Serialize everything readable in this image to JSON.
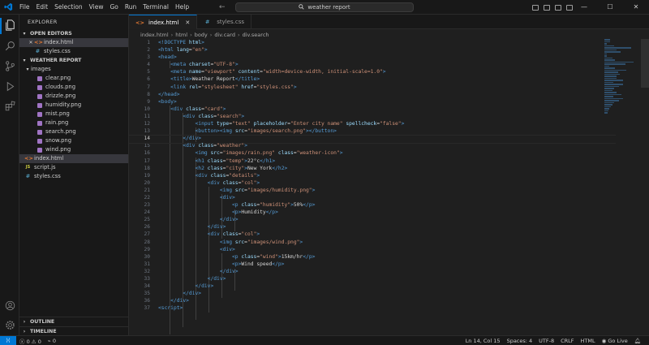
{
  "titlebar": {
    "menu": [
      "File",
      "Edit",
      "Selection",
      "View",
      "Go",
      "Run",
      "Terminal",
      "Help"
    ],
    "search": "weather report"
  },
  "sidebar": {
    "title": "EXPLORER",
    "open_editors_label": "OPEN EDITORS",
    "open_editors": [
      {
        "icon": "<>",
        "name": "index.html",
        "selected": true,
        "closable": true
      },
      {
        "icon": "#",
        "name": "styles.css",
        "selected": false,
        "closable": false
      }
    ],
    "project_label": "WEATHER REPORT",
    "images_folder": "images",
    "images": [
      "clear.png",
      "clouds.png",
      "drizzle.png",
      "humidity.png",
      "mist.png",
      "rain.png",
      "search.png",
      "snow.png",
      "wind.png"
    ],
    "root_files": [
      {
        "icon": "<>",
        "name": "index.html",
        "selected": true
      },
      {
        "icon": "JS",
        "name": "script.js",
        "selected": false
      },
      {
        "icon": "#",
        "name": "styles.css",
        "selected": false
      }
    ],
    "outline_label": "OUTLINE",
    "timeline_label": "TIMELINE"
  },
  "tabs": [
    {
      "icon": "<>",
      "label": "index.html",
      "active": true
    },
    {
      "icon": "#",
      "label": "styles.css",
      "active": false
    }
  ],
  "breadcrumb": [
    "index.html",
    "html",
    "body",
    "div.card",
    "div.search"
  ],
  "editor": {
    "current_line": 14,
    "lines": [
      [
        [
          "t-tag",
          "<!DOCTYPE "
        ],
        [
          "t-attr",
          "html"
        ],
        [
          "t-tag",
          ">"
        ]
      ],
      [
        [
          "t-tag",
          "<html "
        ],
        [
          "t-attr",
          "lang"
        ],
        [
          "t-text",
          "="
        ],
        [
          "t-str",
          "\"en\""
        ],
        [
          "t-tag",
          ">"
        ]
      ],
      [
        [
          "t-tag",
          "<head>"
        ]
      ],
      [
        [
          "t-text",
          "    "
        ],
        [
          "t-tag",
          "<meta "
        ],
        [
          "t-attr",
          "charset"
        ],
        [
          "t-text",
          "="
        ],
        [
          "t-str",
          "\"UTF-8\""
        ],
        [
          "t-tag",
          ">"
        ]
      ],
      [
        [
          "t-text",
          "    "
        ],
        [
          "t-tag",
          "<meta "
        ],
        [
          "t-attr",
          "name"
        ],
        [
          "t-text",
          "="
        ],
        [
          "t-str",
          "\"viewport\" "
        ],
        [
          "t-attr",
          "content"
        ],
        [
          "t-text",
          "="
        ],
        [
          "t-str",
          "\"width=device-width, initial-scale=1.0\""
        ],
        [
          "t-tag",
          ">"
        ]
      ],
      [
        [
          "t-text",
          "    "
        ],
        [
          "t-tag",
          "<title>"
        ],
        [
          "t-text",
          "Weather Report"
        ],
        [
          "t-tag",
          "</title>"
        ]
      ],
      [
        [
          "t-text",
          "    "
        ],
        [
          "t-tag",
          "<link "
        ],
        [
          "t-attr",
          "rel"
        ],
        [
          "t-text",
          "="
        ],
        [
          "t-str",
          "\"stylesheet\" "
        ],
        [
          "t-attr",
          "href"
        ],
        [
          "t-text",
          "="
        ],
        [
          "t-str",
          "\"styles.css\""
        ],
        [
          "t-tag",
          ">"
        ]
      ],
      [
        [
          "t-tag",
          "</head>"
        ]
      ],
      [
        [
          "t-tag",
          "<body>"
        ]
      ],
      [
        [
          "t-text",
          "    "
        ],
        [
          "t-tag",
          "<div "
        ],
        [
          "t-attr",
          "class"
        ],
        [
          "t-text",
          "="
        ],
        [
          "t-str",
          "\"card\""
        ],
        [
          "t-tag",
          ">"
        ]
      ],
      [
        [
          "t-text",
          "        "
        ],
        [
          "t-tag",
          "<div "
        ],
        [
          "t-attr",
          "class"
        ],
        [
          "t-text",
          "="
        ],
        [
          "t-str",
          "\"search\""
        ],
        [
          "t-tag",
          ">"
        ]
      ],
      [
        [
          "t-text",
          "            "
        ],
        [
          "t-tag",
          "<input "
        ],
        [
          "t-attr",
          "type"
        ],
        [
          "t-text",
          "="
        ],
        [
          "t-str",
          "\"text\" "
        ],
        [
          "t-attr",
          "placeholder"
        ],
        [
          "t-text",
          "="
        ],
        [
          "t-str",
          "\"Enter city name\" "
        ],
        [
          "t-attr",
          "spellcheck"
        ],
        [
          "t-text",
          "="
        ],
        [
          "t-str",
          "\"false\""
        ],
        [
          "t-tag",
          ">"
        ]
      ],
      [
        [
          "t-text",
          "            "
        ],
        [
          "t-tag",
          "<button>"
        ],
        [
          "t-tag",
          "<img "
        ],
        [
          "t-attr",
          "src"
        ],
        [
          "t-text",
          "="
        ],
        [
          "t-str",
          "\"images/search.png\""
        ],
        [
          "t-tag",
          "></button>"
        ]
      ],
      [
        [
          "t-text",
          "        "
        ],
        [
          "t-tag",
          "</div>"
        ]
      ],
      [
        [
          "t-text",
          "        "
        ],
        [
          "t-tag",
          "<div "
        ],
        [
          "t-attr",
          "class"
        ],
        [
          "t-text",
          "="
        ],
        [
          "t-str",
          "\"weather\""
        ],
        [
          "t-tag",
          ">"
        ]
      ],
      [
        [
          "t-text",
          "            "
        ],
        [
          "t-tag",
          "<img "
        ],
        [
          "t-attr",
          "src"
        ],
        [
          "t-text",
          "="
        ],
        [
          "t-str",
          "\"images/rain.png\" "
        ],
        [
          "t-attr",
          "class"
        ],
        [
          "t-text",
          "="
        ],
        [
          "t-str",
          "\"weather-icon\""
        ],
        [
          "t-tag",
          ">"
        ]
      ],
      [
        [
          "t-text",
          "            "
        ],
        [
          "t-tag",
          "<h1 "
        ],
        [
          "t-attr",
          "class"
        ],
        [
          "t-text",
          "="
        ],
        [
          "t-str",
          "\"temp\""
        ],
        [
          "t-tag",
          ">"
        ],
        [
          "t-text",
          "22°c"
        ],
        [
          "t-tag",
          "</h1>"
        ]
      ],
      [
        [
          "t-text",
          "            "
        ],
        [
          "t-tag",
          "<h2 "
        ],
        [
          "t-attr",
          "class"
        ],
        [
          "t-text",
          "="
        ],
        [
          "t-str",
          "\"city\""
        ],
        [
          "t-tag",
          ">"
        ],
        [
          "t-text",
          "New York"
        ],
        [
          "t-tag",
          "</h2>"
        ]
      ],
      [
        [
          "t-text",
          "            "
        ],
        [
          "t-tag",
          "<div "
        ],
        [
          "t-attr",
          "class"
        ],
        [
          "t-text",
          "="
        ],
        [
          "t-str",
          "\"details\""
        ],
        [
          "t-tag",
          ">"
        ]
      ],
      [
        [
          "t-text",
          "                "
        ],
        [
          "t-tag",
          "<div "
        ],
        [
          "t-attr",
          "class"
        ],
        [
          "t-text",
          "="
        ],
        [
          "t-str",
          "\"col\""
        ],
        [
          "t-tag",
          ">"
        ]
      ],
      [
        [
          "t-text",
          "                    "
        ],
        [
          "t-tag",
          "<img "
        ],
        [
          "t-attr",
          "src"
        ],
        [
          "t-text",
          "="
        ],
        [
          "t-str",
          "\"images/humidity.png\""
        ],
        [
          "t-tag",
          ">"
        ]
      ],
      [
        [
          "t-text",
          "                    "
        ],
        [
          "t-tag",
          "<div>"
        ]
      ],
      [
        [
          "t-text",
          "                        "
        ],
        [
          "t-tag",
          "<p "
        ],
        [
          "t-attr",
          "class"
        ],
        [
          "t-text",
          "="
        ],
        [
          "t-str",
          "\"humidity\""
        ],
        [
          "t-tag",
          ">"
        ],
        [
          "t-text",
          "50%"
        ],
        [
          "t-tag",
          "</p>"
        ]
      ],
      [
        [
          "t-text",
          "                        "
        ],
        [
          "t-tag",
          "<p>"
        ],
        [
          "t-text",
          "Humidity"
        ],
        [
          "t-tag",
          "</p>"
        ]
      ],
      [
        [
          "t-text",
          "                    "
        ],
        [
          "t-tag",
          "</div>"
        ]
      ],
      [
        [
          "t-text",
          "                "
        ],
        [
          "t-tag",
          "</div>"
        ]
      ],
      [
        [
          "t-text",
          "                "
        ],
        [
          "t-tag",
          "<div "
        ],
        [
          "t-attr",
          "class"
        ],
        [
          "t-text",
          "="
        ],
        [
          "t-str",
          "\"col\""
        ],
        [
          "t-tag",
          ">"
        ]
      ],
      [
        [
          "t-text",
          "                    "
        ],
        [
          "t-tag",
          "<img "
        ],
        [
          "t-attr",
          "src"
        ],
        [
          "t-text",
          "="
        ],
        [
          "t-str",
          "\"images/wind.png\""
        ],
        [
          "t-tag",
          ">"
        ]
      ],
      [
        [
          "t-text",
          "                    "
        ],
        [
          "t-tag",
          "<div>"
        ]
      ],
      [
        [
          "t-text",
          "                        "
        ],
        [
          "t-tag",
          "<p "
        ],
        [
          "t-attr",
          "class"
        ],
        [
          "t-text",
          "="
        ],
        [
          "t-str",
          "\"wind\""
        ],
        [
          "t-tag",
          ">"
        ],
        [
          "t-text",
          "15km/hr"
        ],
        [
          "t-tag",
          "</p>"
        ]
      ],
      [
        [
          "t-text",
          "                        "
        ],
        [
          "t-tag",
          "<p>"
        ],
        [
          "t-text",
          "Wind speed"
        ],
        [
          "t-tag",
          "</p>"
        ]
      ],
      [
        [
          "t-text",
          "                    "
        ],
        [
          "t-tag",
          "</div>"
        ]
      ],
      [
        [
          "t-text",
          "                "
        ],
        [
          "t-tag",
          "</div>"
        ]
      ],
      [
        [
          "t-text",
          "            "
        ],
        [
          "t-tag",
          "</div>"
        ]
      ],
      [
        [
          "t-text",
          "        "
        ],
        [
          "t-tag",
          "</div>"
        ]
      ],
      [
        [
          "t-text",
          "    "
        ],
        [
          "t-tag",
          "</div>"
        ]
      ],
      [
        [
          "t-tag",
          "<script>"
        ]
      ]
    ]
  },
  "statusbar": {
    "errors": "0",
    "warnings": "0",
    "ports": "0",
    "position": "Ln 14, Col 15",
    "spaces": "Spaces: 4",
    "encoding": "UTF-8",
    "eol": "CRLF",
    "language": "HTML",
    "golive": "Go Live"
  },
  "colors": {
    "accent": "#0078d4",
    "tag": "#569cd6",
    "attr": "#9cdcfe",
    "string": "#ce9178",
    "html_icon": "#e37933",
    "css_icon": "#519aba",
    "js_icon": "#cbcb41"
  }
}
